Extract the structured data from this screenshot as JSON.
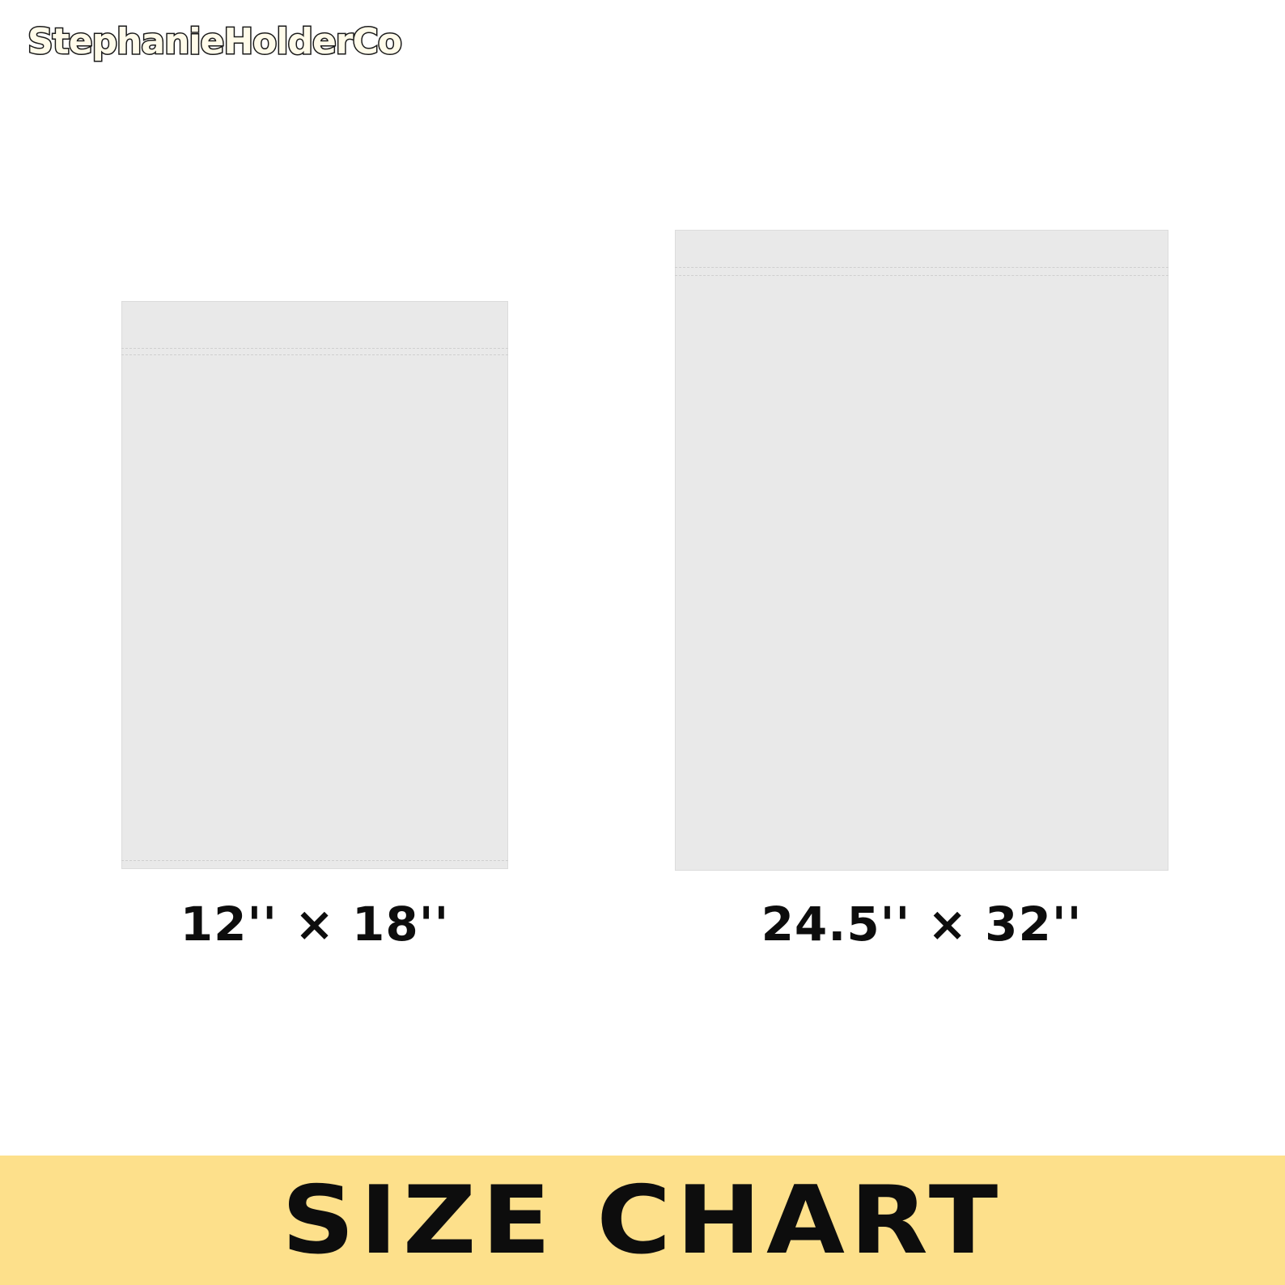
{
  "brand": {
    "name": "StephanieHolderCo"
  },
  "sizes": [
    {
      "label": "12'' × 18''"
    },
    {
      "label": "24.5'' × 32''"
    }
  ],
  "banner": {
    "title": "SIZE CHART",
    "background_color": "#fde08b"
  },
  "colors": {
    "flag": "#e9e9e9",
    "text": "#0d0d0d",
    "page": "#ffffff"
  }
}
